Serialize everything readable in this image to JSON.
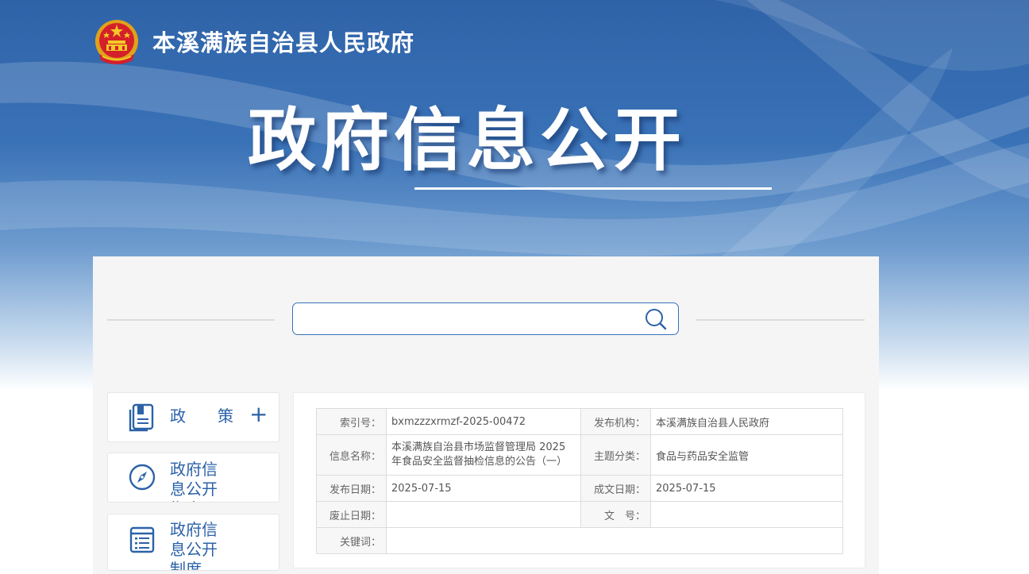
{
  "header": {
    "site_name": "本溪满族自治县人民政府",
    "hero_title": "政府信息公开",
    "emblem_icon": "national-emblem-icon"
  },
  "colors": {
    "banner_blue": "#2f63a8",
    "accent_blue": "#2b62a8",
    "panel_bg": "#f5f5f5"
  },
  "search": {
    "value": "",
    "icon": "search-icon"
  },
  "sidebar": {
    "items": [
      {
        "label": "政　　策",
        "icon": "document-icon",
        "expand_icon": "plus-icon",
        "expand_label": "+"
      },
      {
        "label": "政府信息公开指南",
        "icon": "compass-icon"
      },
      {
        "label": "政府信息公开制度",
        "icon": "list-icon"
      }
    ]
  },
  "meta": {
    "index_no_label": "索引号：",
    "index_no": "bxmzzzxrmzf-2025-00472",
    "publisher_label": "发布机构：",
    "publisher": "本溪满族自治县人民政府",
    "title_label": "信息名称：",
    "title": "本溪满族自治县市场监督管理局 2025年食品安全监督抽检信息的公告（一）",
    "topic_label": "主题分类：",
    "topic": "食品与药品安全监管",
    "publish_date_label": "发布日期：",
    "publish_date": "2025-07-15",
    "created_date_label": "成文日期：",
    "created_date": "2025-07-15",
    "abolish_date_label": "废止日期：",
    "abolish_date": "",
    "doc_no_label": "文　号：",
    "doc_no": "",
    "keywords_label": "关键词：",
    "keywords": ""
  }
}
